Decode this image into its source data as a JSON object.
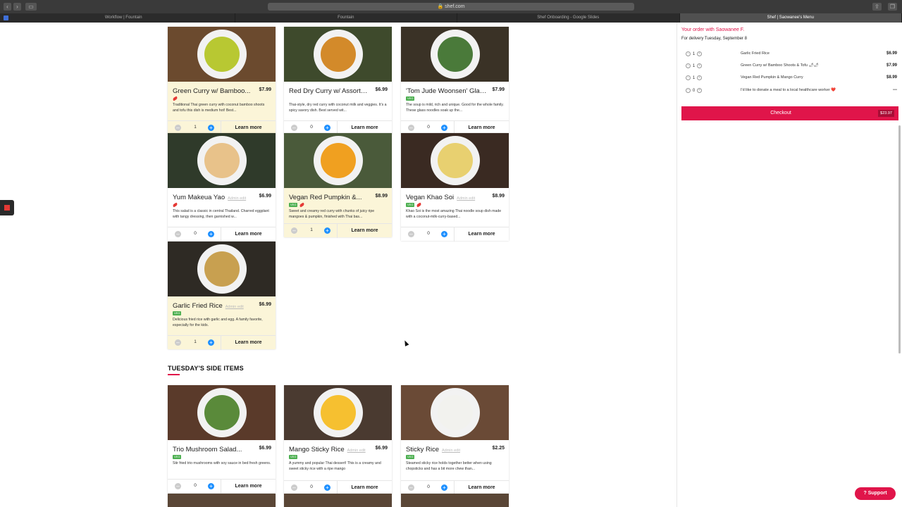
{
  "browser": {
    "url": "shef.com",
    "tabs": [
      "Workflow | Fountain",
      "Fountain",
      "Shef Onboarding - Google Slides",
      "Shef | Saowanee's Menu"
    ]
  },
  "menu": {
    "mains": [
      {
        "title": "Green Curry w/ Bamboo...",
        "price": "$7.99",
        "veg": false,
        "chilis": 1,
        "desc": "Traditional Thai green curry with coconut bamboo shoots and tofu this dish is medium hot! Best...",
        "qty": "1",
        "learn": "Learn more",
        "selected": true,
        "admin_edit": ""
      },
      {
        "title": "Red Dry Curry w/ Assorte...",
        "price": "$6.99",
        "veg": false,
        "chilis": 0,
        "desc": "Thai-style, dry red curry with coconut milk and veggies. It's a spicy savory dish. Best served wit...",
        "qty": "0",
        "learn": "Learn more",
        "selected": false,
        "admin_edit": ""
      },
      {
        "title": "'Tom Jude Woonsen' Glass...",
        "price": "$7.99",
        "veg": true,
        "chilis": 0,
        "desc": "The soup is mild, rich and unique. Good for the whole family. These glass noodles soak up the...",
        "qty": "0",
        "learn": "Learn more",
        "selected": false,
        "admin_edit": ""
      },
      {
        "title": "Yum Makeua Yao",
        "price": "$6.99",
        "veg": false,
        "chilis": 1,
        "desc": "This salad is a classic in central Thailand. Charred eggplant with tangy dressing, then garnished w...",
        "qty": "0",
        "learn": "Learn more",
        "selected": false,
        "admin_edit": "Admin edit"
      },
      {
        "title": "Vegan Red Pumpkin &...",
        "price": "$8.99",
        "veg": true,
        "chilis": 1,
        "desc": "Sweet and creamy red curry with chunks of juicy ripe mangoes & pumpkin, finished with Thai bas...",
        "qty": "1",
        "learn": "Learn more",
        "selected": true,
        "admin_edit": ""
      },
      {
        "title": "Vegan Khao Soi",
        "price": "$8.99",
        "veg": true,
        "chilis": 1,
        "desc": "Khao Soi is the most amazing Thai noodle soup dish made with a coconut-milk-curry-based...",
        "qty": "0",
        "learn": "Learn more",
        "selected": false,
        "admin_edit": "Admin edit"
      },
      {
        "title": "Garlic Fried Rice",
        "price": "$6.99",
        "veg": true,
        "chilis": 0,
        "desc": "Delicious fried rice with garlic and egg. A family favorite, especially for the kids.",
        "qty": "1",
        "learn": "Learn more",
        "selected": true,
        "admin_edit": "Admin edit"
      }
    ],
    "side_section_title": "TUESDAY'S SIDE ITEMS",
    "sides": [
      {
        "title": "Trio Mushroom Salad...",
        "price": "$6.99",
        "veg": true,
        "chilis": 0,
        "desc": "Stir fried trio mushrooms with soy sauce in bed fresh greens.",
        "qty": "0",
        "learn": "Learn more",
        "selected": false,
        "admin_edit": ""
      },
      {
        "title": "Mango Sticky Rice",
        "price": "$6.99",
        "veg": true,
        "chilis": 0,
        "desc": "A yummy and popular Thai dessert! This is a creamy and sweet sticky rice with a ripe mango",
        "qty": "0",
        "learn": "Learn more",
        "selected": false,
        "admin_edit": "Admin edit"
      },
      {
        "title": "Sticky Rice",
        "price": "$2.25",
        "veg": true,
        "chilis": 0,
        "desc": "Steamed sticky rice holds together better when using chopsticks and has a bit more chew than...",
        "qty": "0",
        "learn": "Learn more",
        "selected": false,
        "admin_edit": "Admin edit"
      }
    ]
  },
  "order": {
    "title": "Your order with Saowanee F.",
    "delivery": "For delivery Tuesday, September 8",
    "items": [
      {
        "qty": "1",
        "name": "Garlic Fried Rice",
        "amount": "$6.99"
      },
      {
        "qty": "1",
        "name": "Green Curry w/ Bamboo Shoots & Tofu 🌶🌶",
        "amount": "$7.99"
      },
      {
        "qty": "1",
        "name": "Vegan Red Pumpkin & Mango Curry",
        "amount": "$8.99"
      },
      {
        "qty": "0",
        "name": "I'd like to donate a meal to a local healthcare worker ❤️",
        "amount": "---"
      }
    ],
    "checkout_label": "Checkout",
    "checkout_total": "$23.97"
  },
  "support_label": "Support",
  "colors": {
    "brand": "#e0154a",
    "selected_card": "#fbf5d8",
    "plus": "#1e90ff",
    "veg": "#4caf50"
  }
}
